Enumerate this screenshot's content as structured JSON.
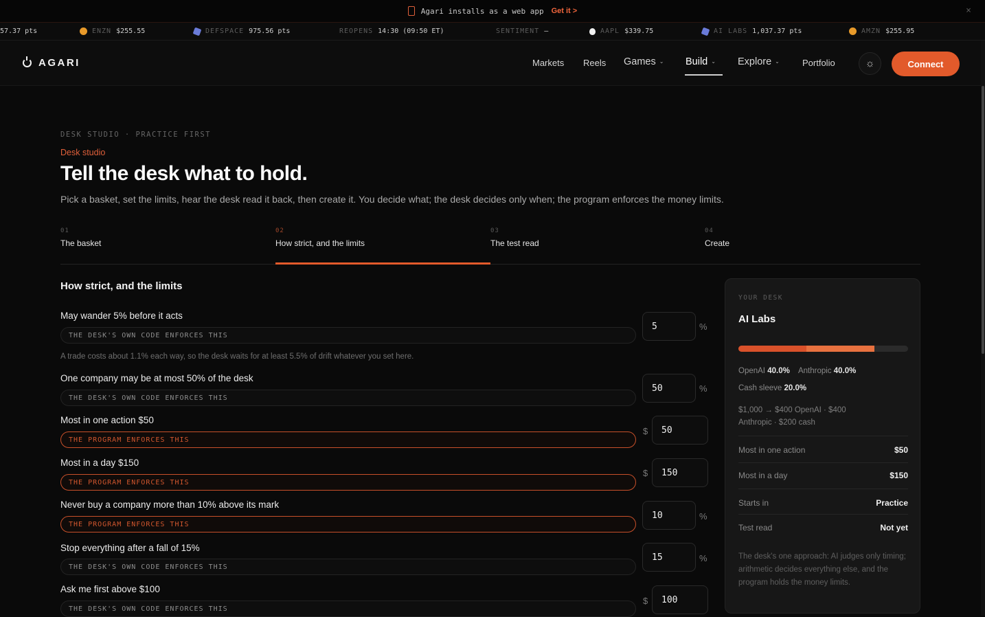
{
  "banner": {
    "text": "Agari installs as a web app",
    "cta": "Get it >",
    "close": "×"
  },
  "ticker": [
    {
      "label": "",
      "value": "57.37 pts",
      "icon": "none"
    },
    {
      "label": "ENZN",
      "value": "$255.55",
      "icon": "coin"
    },
    {
      "label": "DEFSPACE",
      "value": "975.56 pts",
      "icon": "cube"
    },
    {
      "label": "REOPENS",
      "value": "14:30 (09:50 ET)",
      "icon": "none"
    },
    {
      "label": "SENTIMENT",
      "value": "—",
      "icon": "none"
    },
    {
      "label": "AAPL",
      "value": "$339.75",
      "icon": "apple"
    },
    {
      "label": "AI LABS",
      "value": "1,037.37 pts",
      "icon": "cube"
    },
    {
      "label": "AMZN",
      "value": "$255.95",
      "icon": "coin"
    }
  ],
  "nav": {
    "brand": "AGARI",
    "items": [
      "Markets",
      "Reels",
      "Games",
      "Build",
      "Explore",
      "Portfolio"
    ],
    "chevron": "⌄",
    "theme_icon": "☼",
    "connect": "Connect"
  },
  "header": {
    "eyebrow": "DESK STUDIO · PRACTICE FIRST",
    "kicker": "Desk studio",
    "title": "Tell the desk what to hold.",
    "subtitle": "Pick a basket, set the limits, hear the desk read it back, then create it. You decide what; the desk decides only when; the program enforces the money limits."
  },
  "steps": [
    {
      "num": "01",
      "label": "The basket"
    },
    {
      "num": "02",
      "label": "How strict, and the limits"
    },
    {
      "num": "03",
      "label": "The test read"
    },
    {
      "num": "04",
      "label": "Create"
    }
  ],
  "form": {
    "title": "How strict, and the limits",
    "note": "A trade costs about 1.1% each way, so the desk waits for at least 5.5% of drift whatever you set here.",
    "rows": [
      {
        "label": "May wander 5% before it acts",
        "tag": "THE DESK'S OWN CODE ENFORCES THIS",
        "value": "5",
        "unit": "%"
      },
      {
        "label": "One company may be at most 50% of the desk",
        "tag": "THE DESK'S OWN CODE ENFORCES THIS",
        "value": "50",
        "unit": "%"
      },
      {
        "label": "Most in one action $50",
        "tag": "THE PROGRAM ENFORCES THIS",
        "value": "50",
        "unit": "$"
      },
      {
        "label": "Most in a day $150",
        "tag": "THE PROGRAM ENFORCES THIS",
        "value": "150",
        "unit": "$"
      },
      {
        "label": "Never buy a company more than 10% above its mark",
        "tag": "THE PROGRAM ENFORCES THIS",
        "value": "10",
        "unit": "%"
      },
      {
        "label": "Stop everything after a fall of 15%",
        "tag": "THE DESK'S OWN CODE ENFORCES THIS",
        "value": "15",
        "unit": "%"
      },
      {
        "label": "Ask me first above $100",
        "tag": "THE DESK'S OWN CODE ENFORCES THIS",
        "value": "100",
        "unit": "$"
      }
    ]
  },
  "card": {
    "eyebrow": "YOUR DESK",
    "name": "AI Labs",
    "allocation": {
      "openai": 0.4,
      "anthropic": 0.4,
      "cash": 0.2
    },
    "colors": {
      "openai": "#d9512a",
      "anthropic": "#e8713f",
      "cash": "#2b2b2b"
    },
    "openai_label": "OpenAI",
    "openai_pct": "40.0%",
    "anthropic_label": "Anthropic",
    "anthropic_pct": "40.0%",
    "cash_label": "Cash sleeve",
    "cash_pct": "20.0%",
    "breakdown_1": "$1,000 → $400 OpenAI · $400",
    "breakdown_2": "Anthropic · $200 cash",
    "kv": [
      {
        "k": "Most in one action",
        "v": "$50"
      },
      {
        "k": "Most in a day",
        "v": "$150"
      },
      {
        "k": "Starts in",
        "v": "Practice"
      },
      {
        "k": "Test read",
        "v": "Not yet"
      }
    ],
    "footnote": "The desk's one approach: AI judges only timing; arithmetic decides everything else, and the program holds the money limits."
  },
  "colors": {
    "accent": "#e25a2b",
    "background": "#0a0a0a",
    "card": "#171717"
  }
}
